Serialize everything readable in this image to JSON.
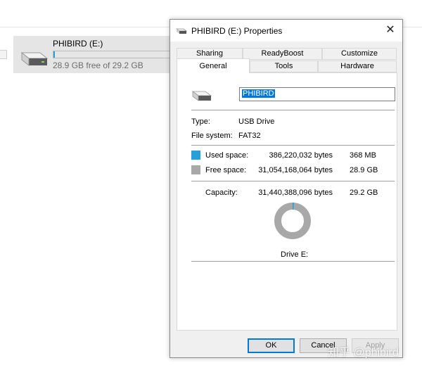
{
  "explorer": {
    "drive": {
      "name": "PHIBIRD (E:)",
      "free_text": "28.9 GB free of 29.2 GB",
      "used_fraction": 0.012,
      "icon": "usb-drive-icon"
    }
  },
  "dialog": {
    "title": "PHIBIRD (E:) Properties",
    "close_glyph": "✕",
    "tabs_top": [
      {
        "label": "Sharing"
      },
      {
        "label": "ReadyBoost"
      },
      {
        "label": "Customize"
      }
    ],
    "tabs_bottom": [
      {
        "label": "General",
        "active": true
      },
      {
        "label": "Tools"
      },
      {
        "label": "Hardware"
      }
    ],
    "general": {
      "volume_label": "PHIBIRD",
      "type_label": "Type:",
      "type_value": "USB Drive",
      "fs_label": "File system:",
      "fs_value": "FAT32",
      "used_label": "Used space:",
      "used_bytes": "386,220,032 bytes",
      "used_size": "368 MB",
      "free_label": "Free space:",
      "free_bytes": "31,054,168,064 bytes",
      "free_size": "28.9 GB",
      "capacity_label": "Capacity:",
      "capacity_bytes": "31,440,388,096 bytes",
      "capacity_size": "29.2 GB",
      "drive_caption": "Drive E:",
      "used_fraction": 0.0123
    },
    "buttons": {
      "ok": "OK",
      "cancel": "Cancel",
      "apply": "Apply"
    }
  },
  "colors": {
    "used": "#26a0da",
    "free": "#a8a8a8",
    "selection": "#0078d7"
  },
  "watermark": "知乎 @phibird"
}
